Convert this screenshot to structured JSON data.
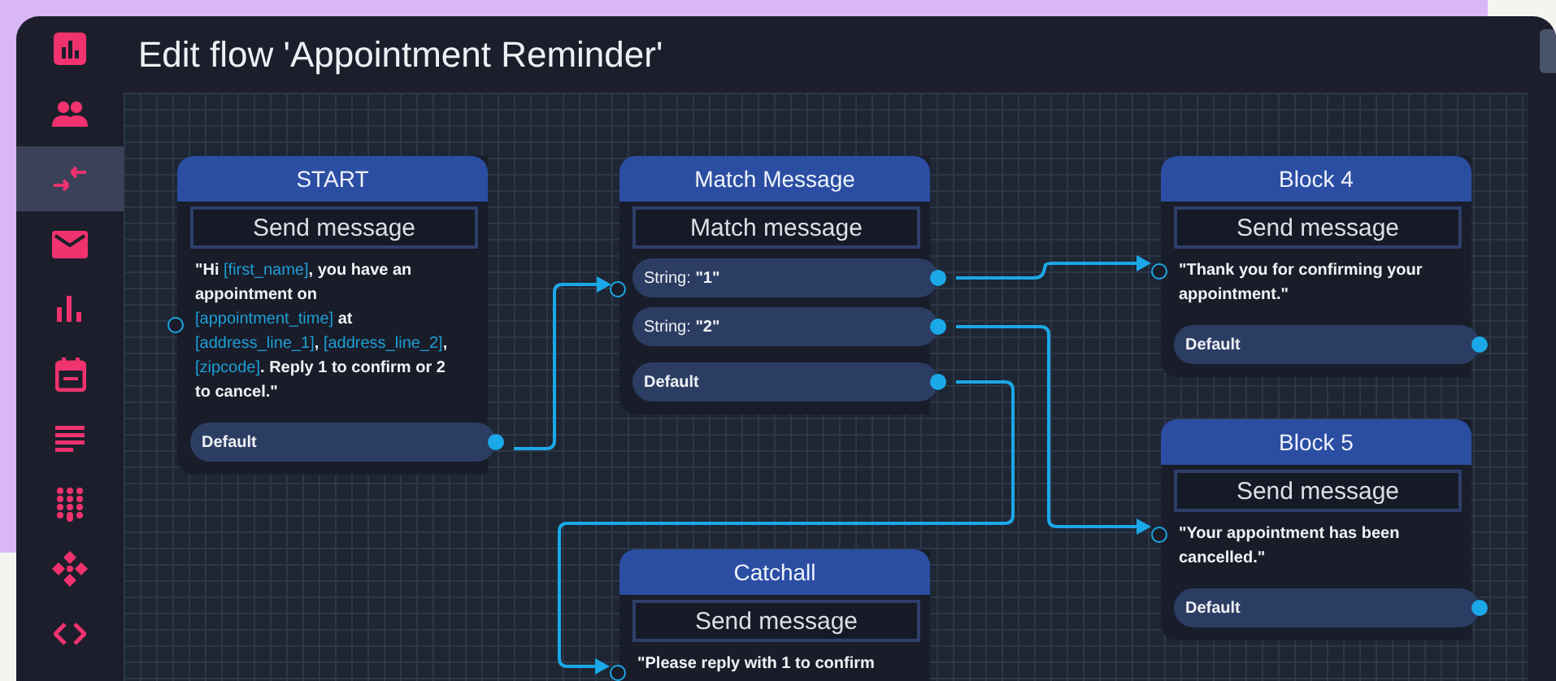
{
  "sidebar": {
    "items": [
      {
        "kind": "dashboard",
        "selected": false
      },
      {
        "kind": "contacts",
        "selected": false
      },
      {
        "kind": "flows",
        "selected": true
      },
      {
        "kind": "messages",
        "selected": false
      },
      {
        "kind": "analytics",
        "selected": false
      },
      {
        "kind": "calendar",
        "selected": false
      },
      {
        "kind": "templates",
        "selected": false
      },
      {
        "kind": "keypad",
        "selected": false
      },
      {
        "kind": "integrations",
        "selected": false
      },
      {
        "kind": "code",
        "selected": false
      }
    ]
  },
  "window": {
    "title": "Edit flow 'Appointment Reminder'"
  },
  "flow": {
    "nodes": [
      {
        "title": "START",
        "action": "Send message",
        "message": [
          {
            "kind": "plain",
            "text": "\"Hi "
          },
          {
            "kind": "variable",
            "text": "[first_name]"
          },
          {
            "kind": "plain",
            "text": ", you have an appointment on "
          },
          {
            "kind": "variable",
            "text": "[appointment_time]"
          },
          {
            "kind": "plain",
            "text": " at "
          },
          {
            "kind": "variable",
            "text": "[address_line_1]"
          },
          {
            "kind": "plain",
            "text": ", "
          },
          {
            "kind": "variable",
            "text": "[address_line_2]"
          },
          {
            "kind": "plain",
            "text": ", "
          },
          {
            "kind": "variable",
            "text": "[zipcode]"
          },
          {
            "kind": "plain",
            "text": ". Reply 1 to confirm or 2 to cancel.\""
          }
        ],
        "outputs": [
          {
            "kind": "default",
            "label": "Default"
          }
        ]
      },
      {
        "title": "Match Message",
        "action": "Match message",
        "outputs": [
          {
            "kind": "string",
            "label": "String: **\"1\"**"
          },
          {
            "kind": "string",
            "label": "String: **\"2\"**"
          },
          {
            "kind": "default",
            "label": "Default"
          }
        ]
      },
      {
        "title": "Block 4",
        "action": "Send message",
        "message": [
          {
            "kind": "plain",
            "text": "\"Thank you for confirming your appointment.\""
          }
        ],
        "outputs": [
          {
            "kind": "default",
            "label": "Default"
          }
        ]
      },
      {
        "title": "Block 5",
        "action": "Send message",
        "message": [
          {
            "kind": "plain",
            "text": "\"Your appointment has been cancelled.\""
          }
        ],
        "outputs": [
          {
            "kind": "default",
            "label": "Default"
          }
        ]
      },
      {
        "title": "Catchall",
        "action": "Send message",
        "message": [
          {
            "kind": "plain",
            "text": "\"Please reply with 1 to confirm"
          }
        ]
      }
    ]
  }
}
